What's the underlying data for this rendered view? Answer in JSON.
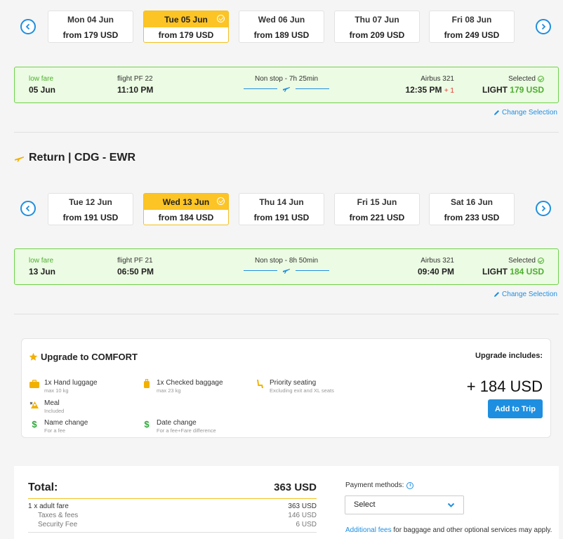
{
  "outbound": {
    "dates": [
      {
        "day": "Mon 04 Jun",
        "price": "from 179 USD",
        "selected": false
      },
      {
        "day": "Tue 05 Jun",
        "price": "from 179 USD",
        "selected": true
      },
      {
        "day": "Wed 06 Jun",
        "price": "from 189 USD",
        "selected": false
      },
      {
        "day": "Thu 07 Jun",
        "price": "from 209 USD",
        "selected": false
      },
      {
        "day": "Fri 08 Jun",
        "price": "from 249 USD",
        "selected": false
      }
    ],
    "flight": {
      "low_fare": "low fare",
      "date": "05 Jun",
      "flight_no": "flight PF 22",
      "depart": "11:10 PM",
      "stops": "Non stop - 7h 25min",
      "aircraft": "Airbus 321",
      "arrive": "12:35 PM",
      "plus_day": "+ 1",
      "selected_label": "Selected",
      "fare_class": "LIGHT",
      "fare_price": "179 USD"
    },
    "change_label": "Change Selection"
  },
  "return": {
    "title": "Return | CDG - EWR",
    "dates": [
      {
        "day": "Tue 12 Jun",
        "price": "from 191 USD",
        "selected": false
      },
      {
        "day": "Wed 13 Jun",
        "price": "from 184 USD",
        "selected": true
      },
      {
        "day": "Thu 14 Jun",
        "price": "from 191 USD",
        "selected": false
      },
      {
        "day": "Fri 15 Jun",
        "price": "from 221 USD",
        "selected": false
      },
      {
        "day": "Sat 16 Jun",
        "price": "from 233 USD",
        "selected": false
      }
    ],
    "flight": {
      "low_fare": "low fare",
      "date": "13 Jun",
      "flight_no": "flight PF 21",
      "depart": "06:50 PM",
      "stops": "Non stop - 8h 50min",
      "aircraft": "Airbus 321",
      "arrive": "09:40 PM",
      "selected_label": "Selected",
      "fare_class": "LIGHT",
      "fare_price": "184 USD"
    },
    "change_label": "Change Selection"
  },
  "upgrade": {
    "title": "Upgrade to COMFORT",
    "includes_label": "Upgrade includes:",
    "price": "+ 184 USD",
    "button": "Add to Trip",
    "features": [
      {
        "title": "1x Hand luggage",
        "sub": "max 10 kg"
      },
      {
        "title": "1x Checked baggage",
        "sub": "max 23 kg"
      },
      {
        "title": "Priority seating",
        "sub": "Excluding exit and XL seats"
      },
      {
        "title": "Meal",
        "sub": "Included"
      },
      {
        "title": "Name change",
        "sub": "For a fee"
      },
      {
        "title": "Date change",
        "sub": "For a fee+Fare difference"
      }
    ]
  },
  "total": {
    "label": "Total:",
    "amount": "363 USD",
    "lines": [
      {
        "label": "1 x adult fare",
        "value": "363 USD"
      },
      {
        "label": "Taxes & fees",
        "value": "146 USD"
      },
      {
        "label": "Security Fee",
        "value": "6 USD"
      }
    ],
    "payment_label": "Payment methods:",
    "payment_select": "Select",
    "additional_link": "Additional fees",
    "additional_text": " for baggage and other optional services may apply."
  },
  "colors": {
    "accent": "#1e8fe0",
    "selected_date": "#fcc425",
    "fare_green": "#4caf2f",
    "flight_bg": "#ecfbe3"
  }
}
